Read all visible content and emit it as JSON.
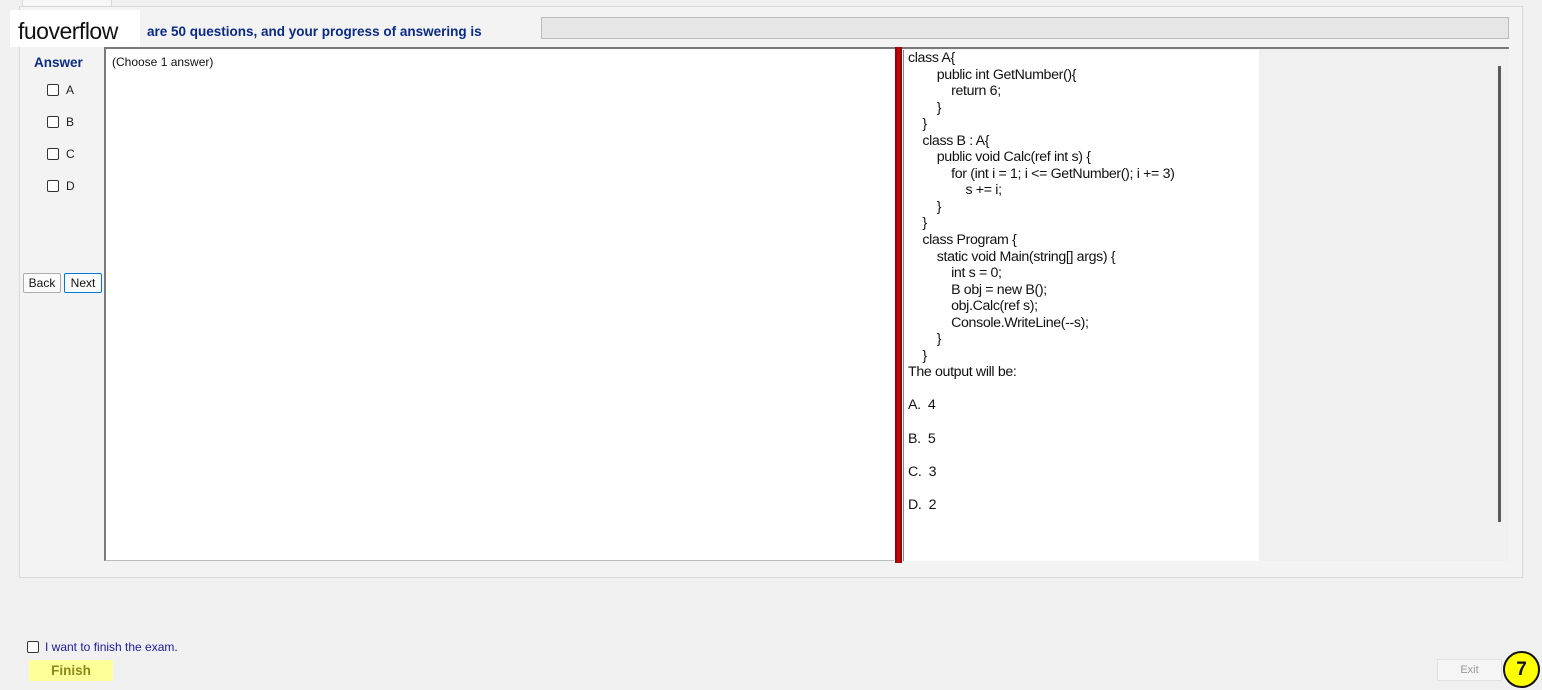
{
  "header": {
    "logo_text": "fuoverflow",
    "progress_label": "are 50 questions, and your progress of answering is",
    "progress_value": 0
  },
  "answer_panel": {
    "title": "Answer",
    "options": [
      "A",
      "B",
      "C",
      "D"
    ]
  },
  "navigation": {
    "back_label": "Back",
    "next_label": "Next"
  },
  "question": {
    "instruction": "(Choose 1 answer)",
    "code_lines": [
      "class A{",
      "        public int GetNumber(){",
      "            return 6;",
      "        }",
      "    }",
      "    class B : A{",
      "        public void Calc(ref int s) {",
      "            for (int i = 1; i <= GetNumber(); i += 3)",
      "                s += i;",
      "        }",
      "    }",
      "    class Program {",
      "        static void Main(string[] args) {",
      "            int s = 0;",
      "            B obj = new B();",
      "            obj.Calc(ref s);",
      "            Console.WriteLine(--s);",
      "        }",
      "    }",
      "The output will be:"
    ],
    "choices": [
      "A.  4",
      "B.  5",
      "C.  3",
      "D.  2"
    ]
  },
  "footer": {
    "finish_checkbox_label": "I want to finish the exam.",
    "finish_label": "Finish",
    "exit_label": "Exit",
    "page_badge": "7"
  },
  "colors": {
    "accent_blue": "#0a2a8a",
    "splitter_red": "#d40000",
    "finish_yellow": "#ffff99",
    "badge_yellow": "#ffff00"
  }
}
